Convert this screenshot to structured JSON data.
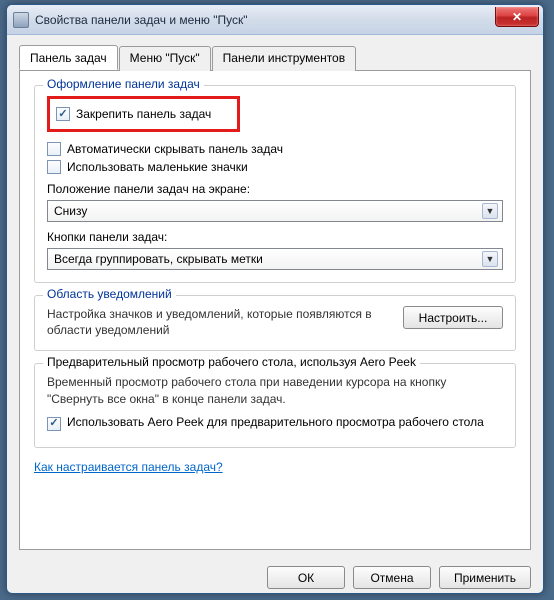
{
  "window": {
    "title": "Свойства панели задач и меню \"Пуск\""
  },
  "tabs": {
    "taskbar": "Панель задач",
    "start": "Меню \"Пуск\"",
    "toolbars": "Панели инструментов"
  },
  "group_appearance": {
    "legend": "Оформление панели задач",
    "lock": "Закрепить панель задач",
    "autohide": "Автоматически скрывать панель задач",
    "small_icons": "Использовать маленькие значки",
    "position_label": "Положение панели задач на экране:",
    "position_value": "Снизу",
    "buttons_label": "Кнопки панели задач:",
    "buttons_value": "Всегда группировать, скрывать метки"
  },
  "group_notif": {
    "legend": "Область уведомлений",
    "desc": "Настройка значков и уведомлений, которые появляются в области уведомлений",
    "button": "Настроить..."
  },
  "group_aero": {
    "legend": "Предварительный просмотр рабочего стола, используя Aero Peek",
    "desc": "Временный просмотр рабочего стола при наведении курсора на кнопку \"Свернуть все окна\" в конце панели задач.",
    "checkbox": "Использовать Aero Peek для предварительного просмотра рабочего стола"
  },
  "help_link": "Как настраивается панель задач?",
  "buttons": {
    "ok": "ОК",
    "cancel": "Отмена",
    "apply": "Применить"
  }
}
